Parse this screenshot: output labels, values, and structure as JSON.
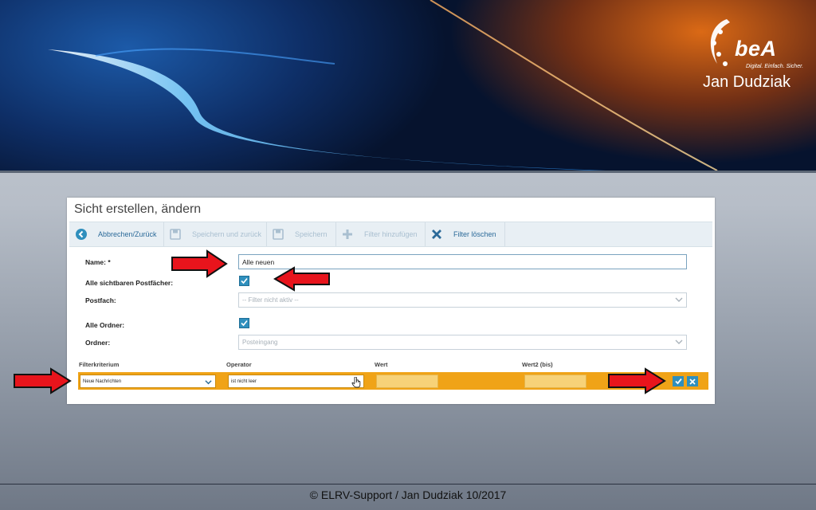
{
  "branding": {
    "logo_text": "beA",
    "tagline": "Digital. Einfach. Sicher.",
    "author": "Jan Dudziak"
  },
  "dialog": {
    "title": "Sicht erstellen, ändern",
    "toolbar": {
      "back": "Abbrechen/Zurück",
      "save_back": "Speichern und zurück",
      "save": "Speichern",
      "add_filter": "Filter hinzufügen",
      "delete_filter": "Filter löschen"
    },
    "form": {
      "name_label": "Name: *",
      "name_value": "Alle neuen",
      "all_mailboxes_label": "Alle sichtbaren Postfächer:",
      "all_mailboxes_checked": true,
      "mailbox_label": "Postfach:",
      "mailbox_value": "-- Filter nicht aktiv --",
      "all_folders_label": "Alle Ordner:",
      "all_folders_checked": true,
      "folder_label": "Ordner:",
      "folder_value": "Posteingang"
    },
    "filter": {
      "headers": {
        "criterion": "Filterkriterium",
        "operator": "Operator",
        "value": "Wert",
        "value2": "Wert2 (bis)"
      },
      "row": {
        "criterion": "Neue Nachrichten",
        "operator": "ist nicht leer",
        "value": "",
        "value2": ""
      }
    }
  },
  "footer": "© ELRV-Support / Jan Dudziak 10/2017",
  "colors": {
    "accent": "#2f8fbd",
    "filter_row": "#f0a317",
    "arrow": "#e8141c"
  }
}
